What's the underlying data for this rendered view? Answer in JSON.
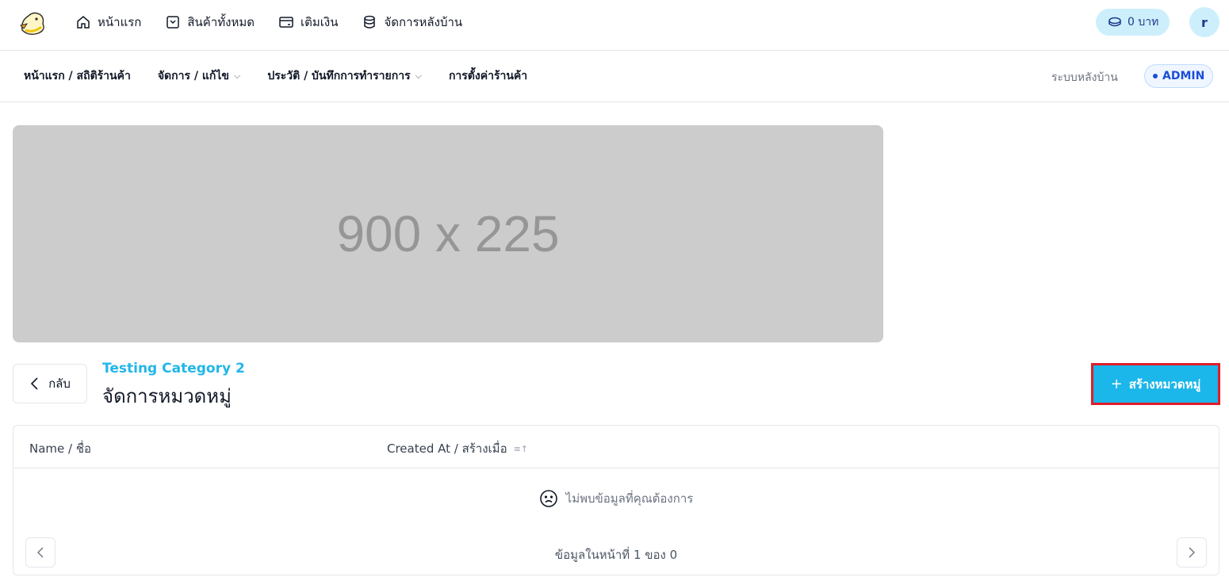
{
  "topbar": {
    "nav": [
      {
        "label": "หน้าแรก",
        "icon": "home-icon"
      },
      {
        "label": "สินค้าทั้งหมด",
        "icon": "product-box-icon"
      },
      {
        "label": "เติมเงิน",
        "icon": "card-icon"
      },
      {
        "label": "จัดการหลังบ้าน",
        "icon": "database-icon"
      }
    ],
    "balance": "0 บาท",
    "avatar_initial": "r"
  },
  "adminbar": {
    "items": [
      {
        "label": "หน้าแรก / สถิติร้านค้า",
        "dropdown": false
      },
      {
        "label": "จัดการ / แก้ไข",
        "dropdown": true
      },
      {
        "label": "ประวัติ / บันทึกการทำรายการ",
        "dropdown": true
      },
      {
        "label": "การตั้งค่าร้านค้า",
        "dropdown": false
      }
    ],
    "system_label": "ระบบหลังบ้าน",
    "role_badge": "ADMIN",
    "chevron": "⌵"
  },
  "banner": {
    "placeholder_text": "900 x 225"
  },
  "heading": {
    "back_label": "กลับ",
    "category": "Testing Category 2",
    "title": "จัดการหมวดหมู่",
    "create_plus": "+",
    "create_label": "สร้างหมวดหมู่"
  },
  "table": {
    "columns": [
      "Name / ชื่อ",
      "Created At / สร้างเมื่อ"
    ],
    "sort_indicator": "≡↑",
    "empty_message": "ไม่พบข้อมูลที่คุณต้องการ",
    "pagination": "ข้อมูลในหน้าที่ 1 ของ 0"
  },
  "colors": {
    "accent": "#1bb6ea",
    "highlight_border": "#e11d2a",
    "pill_bg": "#cdeffc",
    "admin_blue": "#1d4ed8"
  }
}
